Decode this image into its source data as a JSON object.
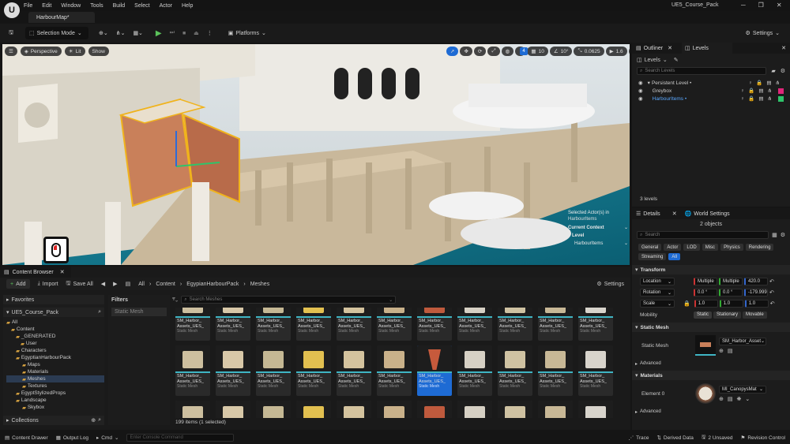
{
  "window": {
    "title": "UE5_Course_Pack",
    "tab": "HarbourMap*"
  },
  "menu": [
    "File",
    "Edit",
    "Window",
    "Tools",
    "Build",
    "Select",
    "Actor",
    "Help"
  ],
  "toolbar": {
    "selection_mode": "Selection Mode",
    "platforms": "Platforms",
    "settings": "Settings"
  },
  "viewport": {
    "perspective": "Perspective",
    "lit": "Lit",
    "show": "Show",
    "grid_snap": "10",
    "rot_snap": "10°",
    "scale_snap": "0.0625",
    "cam_speed": "1.6",
    "badge": "4",
    "overlay": {
      "selected": "Selected Actor(s) in",
      "level_name": "HarbourItems",
      "current_context": "Current Context",
      "level_label": "Level",
      "level_value": "HarbourItems"
    }
  },
  "outliner": {
    "tab_outliner": "Outliner",
    "tab_levels": "Levels",
    "levels_btn": "Levels",
    "search_placeholder": "Search Levels",
    "levels": [
      {
        "name": "Persistent Level •"
      },
      {
        "name": "Greybox"
      },
      {
        "name": "HarbourItems •"
      }
    ],
    "count": "3 levels"
  },
  "details": {
    "tab_details": "Details",
    "tab_world": "World Settings",
    "objects": "2 objects",
    "search_placeholder": "Search",
    "filters": [
      "General",
      "Actor",
      "LOD",
      "Misc",
      "Physics",
      "Rendering",
      "Streaming",
      "All"
    ],
    "transform": "Transform",
    "location": {
      "label": "Location",
      "x": "Multiple",
      "y": "Multiple",
      "z": "420.0"
    },
    "rotation": {
      "label": "Rotation",
      "x": "0.0 °",
      "y": "0.0 °",
      "z": "-179.999"
    },
    "scale": {
      "label": "Scale",
      "x": "1.0",
      "y": "1.0",
      "z": "1.0"
    },
    "mobility": {
      "label": "Mobility",
      "opts": [
        "Static",
        "Stationary",
        "Movable"
      ]
    },
    "static_mesh_section": "Static Mesh",
    "static_mesh_label": "Static Mesh",
    "static_mesh_value": "SM_Harbor_Asset",
    "advanced": "Advanced",
    "materials": "Materials",
    "element0": "Element 0",
    "material_value": "MI_CanopysMat",
    "advanced2": "Advanced"
  },
  "content_browser": {
    "tab": "Content Browser",
    "add": "Add",
    "import": "Import",
    "save_all": "Save All",
    "breadcrumb": [
      "All",
      "Content",
      "EgypianHarbourPack",
      "Meshes"
    ],
    "settings": "Settings",
    "favorites": "Favorites",
    "project": "UE5_Course_Pack",
    "tree": [
      "All",
      "Content",
      "_GENERATED",
      "User",
      "Characters",
      "EgyptianHarbourPack",
      "Maps",
      "Materials",
      "Meshes",
      "Textures",
      "EgyptStylizedProps",
      "Landscape",
      "Skybox"
    ],
    "collections": "Collections",
    "filters": "Filters",
    "filter_item": "Static Mesh",
    "search_placeholder": "Search Meshes",
    "row1": [
      {
        "name": "SM_Harbor_",
        "sub": "Assets_UES",
        "type": "Static Mesh"
      }
    ],
    "tile_name": "SM_Harbor_",
    "tile_sub": "Assets_UES_",
    "tile_type": "Static Mesh",
    "status": "199 items (1 selected)"
  },
  "statusbar": {
    "content_drawer": "Content Drawer",
    "output_log": "Output Log",
    "cmd": "Cmd",
    "console_placeholder": "Enter Console Command",
    "trace": "Trace",
    "derived": "Derived Data",
    "unsaved": "2 Unsaved",
    "revision": "Revision Control"
  },
  "colors": {
    "accent": "#1e6bd4",
    "teal": "#3fb5c4",
    "level_pink": "#e0267a",
    "level_green": "#2ec46a"
  }
}
